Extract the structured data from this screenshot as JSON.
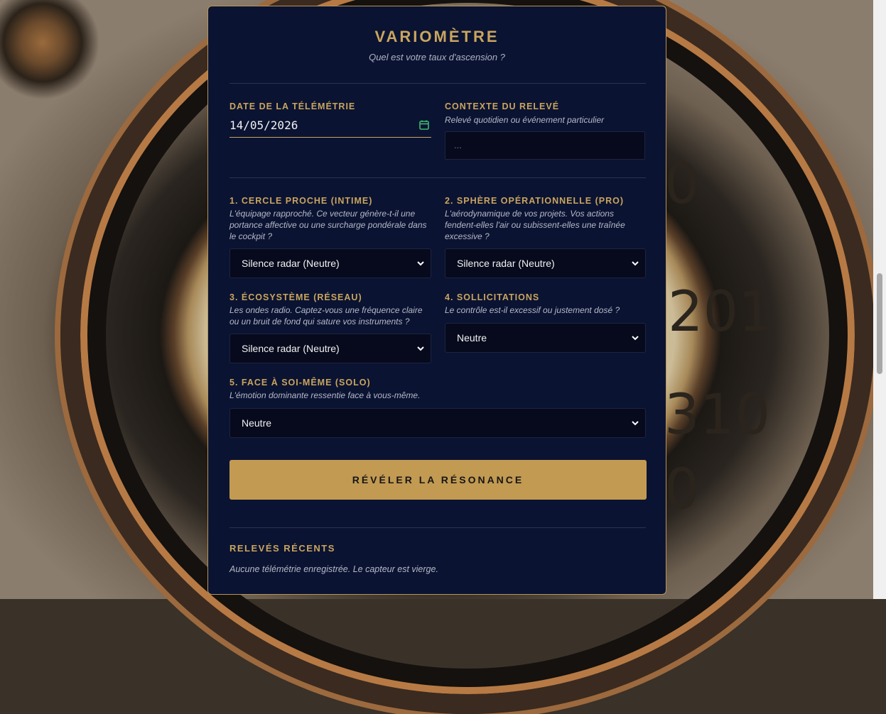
{
  "app": {
    "title": "VARIOMÈTRE",
    "subtitle": "Quel est votre taux d'ascension ?"
  },
  "date_field": {
    "label": "DATE DE LA TÉLÉMÉTRIE",
    "value": "14/05/2026"
  },
  "context_field": {
    "label": "CONTEXTE DU RELEVÉ",
    "help": "Relevé quotidien ou événement particulier",
    "placeholder": "..."
  },
  "sections": [
    {
      "label": "1. CERCLE PROCHE (INTIME)",
      "help": "L'équipage rapproché. Ce vecteur génère-t-il une portance affective ou une surcharge pondérale dans le cockpit ?",
      "selected": "Silence radar (Neutre)"
    },
    {
      "label": "2. SPHÈRE OPÉRATIONNELLE (PRO)",
      "help": "L'aérodynamique de vos projets. Vos actions fendent-elles l'air ou subissent-elles une traînée excessive ?",
      "selected": "Silence radar (Neutre)"
    },
    {
      "label": "3. ÉCOSYSTÈME (RÉSEAU)",
      "help": "Les ondes radio. Captez-vous une fréquence claire ou un bruit de fond qui sature vos instruments ?",
      "selected": "Silence radar (Neutre)"
    },
    {
      "label": "4. SOLLICITATIONS",
      "help": "Le contrôle est-il excessif ou justement dosé ?",
      "selected": "Neutre"
    },
    {
      "label": "5. FACE À SOI-MÊME (SOLO)",
      "help": "L'émotion dominante ressentie face à vous-même.",
      "selected": "Neutre"
    }
  ],
  "cta": {
    "label": "RÉVÉLER LA RÉSONANCE"
  },
  "recent": {
    "label": "RELEVÉS RÉCENTS",
    "empty_text": "Aucune télémétrie enregistrée. Le capteur est vierge."
  },
  "colors": {
    "accent": "#c9a55e",
    "panel_bg": "#0b1332",
    "button_bg": "#c29a52"
  }
}
